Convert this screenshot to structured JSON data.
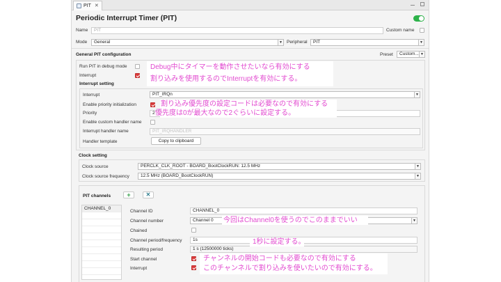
{
  "tab": {
    "label": "PIT"
  },
  "header": {
    "title": "Periodic Interrupt Timer (PIT)",
    "enabled": true
  },
  "general": {
    "name_label": "Name",
    "name_value": "PIT",
    "custom_name_label": "Custom name",
    "mode_label": "Mode",
    "mode_value": "General",
    "peripheral_label": "Peripheral",
    "peripheral_value": "PIT"
  },
  "config": {
    "heading": "General PIT configuration",
    "preset_label": "Preset",
    "preset_value": "Custom...",
    "run_debug_label": "Run PIT in debug mode",
    "interrupt_label": "Interrupt"
  },
  "interrupt_setting": {
    "heading": "Interrupt setting",
    "interrupt_label": "Interrupt",
    "interrupt_value": "PIT_IRQn",
    "priority_init_label": "Enable priority initialization",
    "priority_label": "Priority",
    "priority_value": "2",
    "custom_handler_label": "Enable custom handler name",
    "handler_name_label": "Interrupt handler name",
    "handler_name_value": "PIT_IRQHANDLER",
    "template_label": "Handler template",
    "copy_button": "Copy to clipboard"
  },
  "clock": {
    "heading": "Clock setting",
    "source_label": "Clock source",
    "source_value": "PERCLK_CLK_ROOT - BOARD_BootClockRUN: 12.5 MHz",
    "frequency_label": "Clock source frequency",
    "frequency_value": "12.5 MHz (BOARD_BootClockRUN)"
  },
  "channels": {
    "heading": "PIT channels",
    "add_symbol": "+",
    "remove_symbol": "✕",
    "list": [
      "CHANNEL_0"
    ],
    "id_label": "Channel ID",
    "id_value": "CHANNEL_0",
    "number_label": "Channel number",
    "number_value": "Channel 0",
    "chained_label": "Chained",
    "period_label": "Channel period/frequency",
    "period_value": "1s",
    "resulting_label": "Resulting period",
    "resulting_value": "1 s (12500000 ticks)",
    "start_label": "Start channel",
    "interrupt_label": "Interrupt"
  },
  "annotations": {
    "debug_note": "Debug中にタイマーを動作させたいなら有効にする",
    "interrupt_note": "割り込みを使用するのでInterruptを有効にする。",
    "priority_init_note": "割り込み優先度の設定コードは必要なので有効にする",
    "priority_note": "優先度は0が最大なので2ぐらいに設定する。",
    "channel_note": "今回はChannel0を使うのでこのままでいい",
    "period_note": "1秒に設定する。",
    "start_note": "チャンネルの開始コードも必要なので有効にする",
    "channel_interrupt_note": "このチャンネルで割り込みを使いたいので有効にする。"
  },
  "colors": {
    "annotation": "#e24bd0",
    "toggle_on": "#2db24a",
    "checkbox_on": "#d93b3b"
  }
}
